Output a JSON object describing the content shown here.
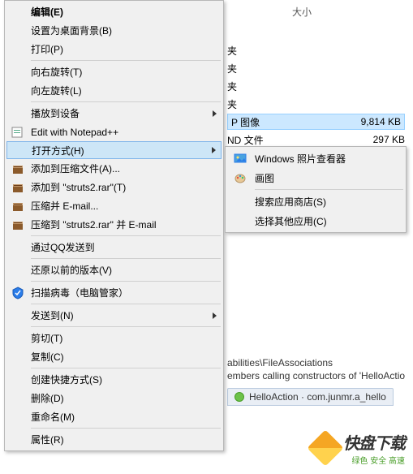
{
  "header": {
    "size_label": "大小"
  },
  "files": [
    {
      "type": "夹"
    },
    {
      "type": "夹"
    },
    {
      "type": "夹"
    },
    {
      "type": "夹"
    },
    {
      "type": "P 图像",
      "size": "9,814 KB",
      "selected": true
    },
    {
      "type": "ND 文件",
      "size": "297 KB"
    }
  ],
  "menu": {
    "edit": "编辑(E)",
    "set_bg": "设置为桌面背景(B)",
    "print": "打印(P)",
    "rotate_r": "向右旋转(T)",
    "rotate_l": "向左旋转(L)",
    "cast": "播放到设备",
    "notepadpp": "Edit with Notepad++",
    "open_with": "打开方式(H)",
    "rar_add": "添加到压缩文件(A)...",
    "rar_add_to": "添加到 \"struts2.rar\"(T)",
    "rar_email": "压缩并 E-mail...",
    "rar_email_to": "压缩到 \"struts2.rar\" 并 E-mail",
    "qq_send": "通过QQ发送到",
    "restore": "还原以前的版本(V)",
    "scan": "扫描病毒（电脑管家）",
    "send_to": "发送到(N)",
    "cut": "剪切(T)",
    "copy": "复制(C)",
    "shortcut": "创建快捷方式(S)",
    "delete": "删除(D)",
    "rename": "重命名(M)",
    "props": "属性(R)"
  },
  "submenu": {
    "photo_viewer": "Windows 照片查看器",
    "paint": "画图",
    "search_store": "搜索应用商店(S)",
    "choose_other": "选择其他应用(C)"
  },
  "bottom": {
    "path": "abilities\\FileAssociations",
    "desc": "embers calling constructors of 'HelloActio",
    "tab": "HelloAction · com.junmr.a_hello"
  },
  "watermark": {
    "main": "快盘下载",
    "sub": "绿色 安全 高速"
  }
}
